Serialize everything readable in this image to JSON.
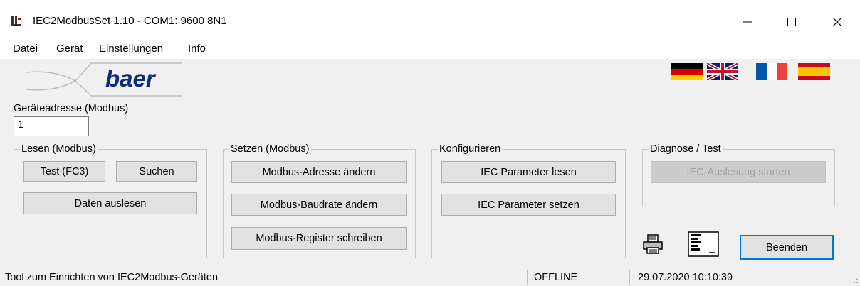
{
  "window": {
    "title": "IEC2ModbusSet 1.10 - COM1: 9600 8N1",
    "controls": {
      "minimize": "—",
      "maximize": "☐",
      "close": "✕"
    }
  },
  "menu": {
    "items": [
      {
        "accel": "D",
        "rest": "atei"
      },
      {
        "accel": "G",
        "rest": "erät"
      },
      {
        "accel": "E",
        "rest": "instellungen"
      },
      {
        "accel": "I",
        "rest": "nfo"
      }
    ]
  },
  "logo": {
    "text": "baer",
    "color": "#0a2d80"
  },
  "flags": [
    "german-flag-icon",
    "uk-flag-icon",
    "french-flag-icon",
    "spanish-flag-icon"
  ],
  "address": {
    "label": "Geräteadresse (Modbus)",
    "value": "1"
  },
  "groups": {
    "lesen": {
      "title": "Lesen (Modbus)",
      "test": "Test (FC3)",
      "search": "Suchen",
      "read": "Daten auslesen"
    },
    "setzen": {
      "title": "Setzen (Modbus)",
      "addr": "Modbus-Adresse ändern",
      "baud": "Modbus-Baudrate ändern",
      "reg": "Modbus-Register schreiben"
    },
    "konfig": {
      "title": "Konfigurieren",
      "read": "IEC Parameter lesen",
      "set": "IEC Parameter setzen"
    },
    "diag": {
      "title": "Diagnose / Test",
      "start": "IEC-Auslesung starten"
    }
  },
  "actions": {
    "exit": "Beenden"
  },
  "status": {
    "text": "Tool zum Einrichten von IEC2Modbus-Geräten",
    "connection": "OFFLINE",
    "datetime": "29.07.2020 10:10:39"
  },
  "colors": {
    "focus": "#0078d7",
    "disabled_text": "#a0a0a0"
  }
}
